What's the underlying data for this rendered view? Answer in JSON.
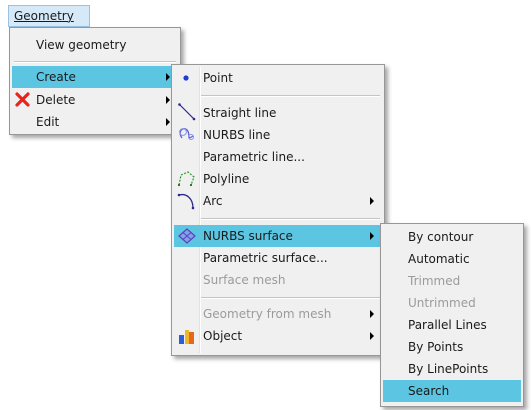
{
  "menubar": {
    "geometry_label": "Geometry"
  },
  "geometry_menu": {
    "items": [
      {
        "label": "View geometry"
      },
      {
        "label": "Create"
      },
      {
        "label": "Delete"
      },
      {
        "label": "Edit"
      }
    ]
  },
  "create_menu": {
    "items": [
      {
        "label": "Point"
      },
      {
        "label": "Straight line"
      },
      {
        "label": "NURBS line"
      },
      {
        "label": "Parametric line..."
      },
      {
        "label": "Polyline"
      },
      {
        "label": "Arc"
      },
      {
        "label": "NURBS surface"
      },
      {
        "label": "Parametric surface..."
      },
      {
        "label": "Surface mesh"
      },
      {
        "label": "Geometry from mesh"
      },
      {
        "label": "Object"
      }
    ]
  },
  "nurbs_surface_menu": {
    "items": [
      {
        "label": "By contour"
      },
      {
        "label": "Automatic"
      },
      {
        "label": "Trimmed"
      },
      {
        "label": "Untrimmed"
      },
      {
        "label": "Parallel Lines"
      },
      {
        "label": "By Points"
      },
      {
        "label": "By LinePoints"
      },
      {
        "label": "Search"
      }
    ]
  },
  "colors": {
    "highlight": "#5bc5e2",
    "menu_background": "#f0f0f0",
    "disabled_text": "#9b9b9b",
    "delete_icon": "#e8251d"
  }
}
